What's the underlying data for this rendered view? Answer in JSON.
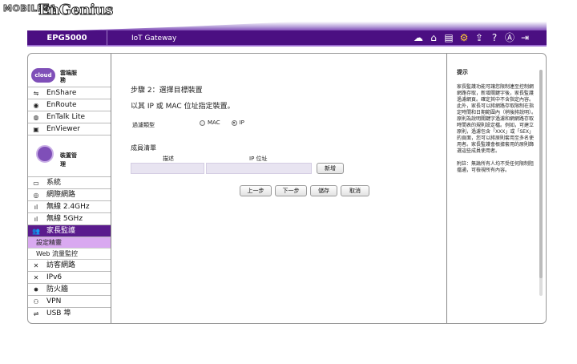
{
  "watermark": "MOBILE01",
  "brand": "EnGenius",
  "header": {
    "model": "EPG5000",
    "subtitle": "IoT Gateway",
    "icons": [
      "cloud-download-icon",
      "home-icon",
      "pages-icon",
      "gear-icon",
      "upload-icon",
      "help-icon",
      "account-icon",
      "logout-icon"
    ]
  },
  "sidebar": {
    "cloud_logo": "cloud",
    "cloud_title": "雲端服務",
    "cloud_items": [
      {
        "label": "EnShare",
        "icon": "share-icon"
      },
      {
        "label": "EnRoute",
        "icon": "location-icon"
      },
      {
        "label": "EnTalk Lite",
        "icon": "talk-icon"
      },
      {
        "label": "EnViewer",
        "icon": "viewer-icon"
      }
    ],
    "mgmt_title": "裝置管理",
    "items": [
      {
        "label": "系統",
        "icon": "monitor-icon"
      },
      {
        "label": "網際網路",
        "icon": "globe-icon"
      },
      {
        "label": "無線 2.4GHz",
        "icon": "wifi-icon"
      },
      {
        "label": "無線 5GHz",
        "icon": "wifi-icon"
      },
      {
        "label": "家長監護",
        "icon": "users-icon"
      },
      {
        "label": "訪客網路",
        "icon": "tools-icon"
      },
      {
        "label": "IPv6",
        "icon": "tools-icon"
      },
      {
        "label": "防火牆",
        "icon": "firewall-icon"
      },
      {
        "label": "VPN",
        "icon": "vpn-icon"
      },
      {
        "label": "USB 埠",
        "icon": "usb-icon"
      }
    ],
    "sub_items": [
      "設定精靈",
      "Web 流量監控"
    ]
  },
  "content": {
    "step_title": "步驟 2：選擇目標裝置",
    "step_desc": "以其 IP 或 MAC 位址指定裝置。",
    "filter_label": "過濾類型",
    "radio_mac": "MAC",
    "radio_ip": "IP",
    "selected": "IP",
    "members_title": "成員清單",
    "col_desc": "描述",
    "col_ip": "IP 位址",
    "desc_value": "",
    "ip_value": "",
    "add_button": "新增",
    "prev_button": "上一步",
    "next_button": "下一步",
    "save_button": "儲存",
    "cancel_button": "取消"
  },
  "hint": {
    "title": "提示",
    "body": "家長監護功能可讓您限制連至控制網網路存取，新增關鍵字後，家長監護過濾網頁。確定其中不含指定內容。此外，家長可以將網路存取限制在指定時間和日期範圍內（稍後將說明）。原則為說明關鍵字過濾和網網路存取時間表的規則設定檔。例如，可建立原則，過濾包含「XXX」或「SEX」的頁面，您可以將原則套用至多名使用者。家長監護會根據套用的原則篩選這些成員使用者。",
    "note": "附註：無論所有人均不受任何限制阻擋通，可檢視所有內容。"
  }
}
